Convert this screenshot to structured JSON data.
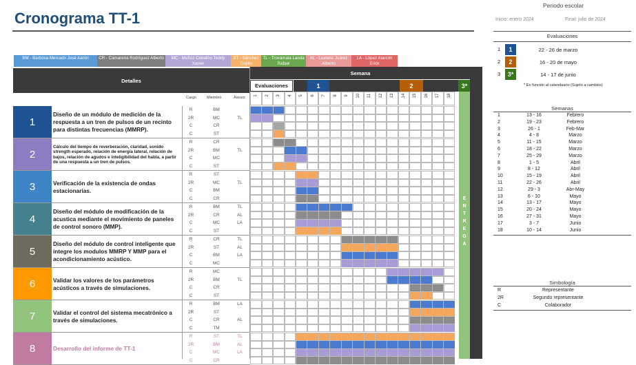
{
  "title": "Cronograma TT-1",
  "periodo": {
    "label": "Periodo escolar",
    "inicio": "Inicio:  enero 2024",
    "final": "Final:  julio de 2024"
  },
  "members": [
    {
      "text": "BM - Barbosa Mercado José Aarón",
      "color": "#5b9bd5"
    },
    {
      "text": "CR - Camarena Rodríguez Alberto",
      "color": "#7f7f7f"
    },
    {
      "text": "MC - Muñoz Ceballos Teddy Xavier",
      "color": "#b4a7d6"
    },
    {
      "text": "ST - Sánchez Trujillo",
      "color": "#f6b26b"
    },
    {
      "text": "TL - Trovamala Landa Rafael",
      "color": "#6aa84f"
    },
    {
      "text": "AL - Luviano Juárez Alberto",
      "color": "#ea9999"
    },
    {
      "text": "LA - López Alarcón Erick",
      "color": "#e06666"
    }
  ],
  "table": {
    "detalles": "Detalles",
    "cargo": "Cargo",
    "miembro": "Miembro",
    "asesor": "Asesor",
    "semana": "Semana",
    "evaluaciones": "Evaluaciones",
    "eval_marks": [
      "1",
      "2",
      "3*"
    ],
    "weeks": [
      "1",
      "2",
      "3",
      "4",
      "5",
      "6",
      "7",
      "8",
      "9",
      "10",
      "11",
      "12",
      "13",
      "14",
      "15",
      "16",
      "17",
      "18"
    ],
    "entrega": "ENTREGA"
  },
  "tasks": [
    {
      "num": "1",
      "color": "#1f5394",
      "desc": "Diseño de un módulo de medición de la respuesta a un tren de pulsos de un recinto para distintas frecuencias (MMRP).",
      "small": false,
      "cargos": [
        "R",
        "2R",
        "C",
        "C"
      ],
      "miembros": [
        "BM",
        "MC",
        "CR",
        "ST"
      ],
      "asesores": [
        "",
        "TL",
        "",
        ""
      ],
      "bars": [
        [
          1,
          3,
          "#4a7bd0"
        ],
        [
          1,
          2,
          "#a99bd6"
        ],
        [
          3,
          3,
          "#a5a5a5"
        ],
        [
          3,
          3,
          "#f6a75e"
        ]
      ]
    },
    {
      "num": "2",
      "color": "#8e7cc3",
      "desc": "Cálculo del tiempo de reverberación, claridad, sonido strength esperado, relación de energía lateral, relación de bajos, relación de agudos e inteligibilidad del habla, a partir de una respuesta a un tren de pulsos.",
      "small": true,
      "cargos": [
        "R",
        "2R",
        "C",
        "C"
      ],
      "miembros": [
        "CR",
        "BM",
        "MC",
        "ST"
      ],
      "asesores": [
        "",
        "TL",
        "",
        ""
      ],
      "bars": [
        [
          3,
          4,
          "#8c8c8c"
        ],
        [
          4,
          5,
          "#4a7bd0"
        ],
        [
          4,
          5,
          "#a99bd6"
        ],
        [
          3,
          4,
          "#f6a75e"
        ]
      ]
    },
    {
      "num": "3",
      "color": "#3d85c6",
      "desc": "Verificación de la existencia de ondas estacionarias.",
      "small": false,
      "cargos": [
        "R",
        "2R",
        "C",
        "C"
      ],
      "miembros": [
        "ST",
        "MC",
        "BM",
        "CR"
      ],
      "asesores": [
        "",
        "TL",
        "",
        ""
      ],
      "bars": [
        [
          5,
          6,
          "#f6a75e"
        ],
        [
          5,
          6,
          "#a99bd6"
        ],
        [
          5,
          6,
          "#4a7bd0"
        ],
        [
          5,
          6,
          "#8c8c8c"
        ]
      ]
    },
    {
      "num": "4",
      "color": "#45818e",
      "desc": "Diseño del módulo de modificación de la acustica mediante el movimiento de paneles de control sonoro (MMP).",
      "small": false,
      "cargos": [
        "R",
        "2R",
        "C",
        "C"
      ],
      "miembros": [
        "BM",
        "CR",
        "MC",
        "ST"
      ],
      "asesores": [
        "TL",
        "AL",
        "LA",
        ""
      ],
      "bars": [
        [
          5,
          9,
          "#4a7bd0"
        ],
        [
          5,
          8,
          "#8c8c8c"
        ],
        [
          5,
          8,
          "#a99bd6"
        ],
        [
          5,
          8,
          "#f6a75e"
        ]
      ]
    },
    {
      "num": "5",
      "color": "#6d6a5e",
      "desc": "Diseño del módulo de control inteligente que integre los modulos MMRP Y MMP para el acondicionamiento acústico.",
      "small": false,
      "cargos": [
        "R",
        "2R",
        "C",
        "C"
      ],
      "miembros": [
        "CR",
        "ST",
        "BM",
        "MC"
      ],
      "asesores": [
        "TL",
        "AL",
        "LA",
        ""
      ],
      "bars": [
        [
          9,
          13,
          "#8c8c8c"
        ],
        [
          9,
          13,
          "#f6a75e"
        ],
        [
          9,
          13,
          "#4a7bd0"
        ],
        [
          9,
          13,
          "#a99bd6"
        ]
      ]
    },
    {
      "num": "6",
      "color": "#ff9900",
      "desc": "Validar los valores de los parámetros acústicos a través de simulaciones.",
      "small": false,
      "cargos": [
        "R",
        "2R",
        "C",
        "C"
      ],
      "miembros": [
        "MC",
        "BM",
        "CR",
        "ST"
      ],
      "asesores": [
        "",
        "TL",
        "",
        ""
      ],
      "bars": [
        [
          13,
          17,
          "#a99bd6"
        ],
        [
          13,
          16,
          "#4a7bd0"
        ],
        [
          15,
          17,
          "#8c8c8c"
        ],
        [
          15,
          16,
          "#f6a75e"
        ]
      ]
    },
    {
      "num": "7",
      "color": "#93c47d",
      "desc": "Validar el control del sistema mecatrónico a través de simulaciones.",
      "small": false,
      "cargos": [
        "R",
        "2R",
        "C",
        "C"
      ],
      "miembros": [
        "BM",
        "ST",
        "CR",
        "TM"
      ],
      "asesores": [
        "LA",
        "",
        "AL",
        ""
      ],
      "bars": [
        [
          15,
          18,
          "#4a7bd0"
        ],
        [
          15,
          18,
          "#f6a75e"
        ],
        [
          15,
          18,
          "#8c8c8c"
        ],
        [
          15,
          18,
          "#a99bd6"
        ]
      ]
    },
    {
      "num": "8",
      "color": "#c27ba0",
      "desc": "Desarrollo del informe de TT-1",
      "small": false,
      "pink": true,
      "cargos": [
        "R",
        "2R",
        "C",
        "C"
      ],
      "miembros": [
        "ST",
        "BM",
        "MC",
        "CR"
      ],
      "asesores": [
        "TL",
        "AL",
        "LA",
        ""
      ],
      "bars": [
        [
          5,
          18,
          "#f6a75e"
        ],
        [
          5,
          18,
          "#4a7bd0"
        ],
        [
          5,
          18,
          "#a99bd6"
        ],
        [
          5,
          18,
          "#8c8c8c"
        ]
      ]
    }
  ],
  "evaluaciones": {
    "title": "Evaluaciones",
    "items": [
      {
        "n": "1",
        "mark": "1",
        "color": "#1f5394",
        "range": "22 - 26 de marzo"
      },
      {
        "n": "2",
        "mark": "2",
        "color": "#b45f06",
        "range": "16 - 20 de mayo"
      },
      {
        "n": "3",
        "mark": "3*",
        "color": "#38761d",
        "range": "14 - 17 de junio"
      }
    ],
    "note": "* En función al calendaario (Sujeto a cambios)"
  },
  "semanas": {
    "title": "Semanas",
    "rows": [
      [
        "1",
        "13 - 16",
        "Febrero"
      ],
      [
        "2",
        "19 - 23",
        "Febrero"
      ],
      [
        "3",
        "26 - 1",
        "Feb-Mar"
      ],
      [
        "4",
        "4 - 8",
        "Marzo"
      ],
      [
        "5",
        "11 - 15",
        "Marzo"
      ],
      [
        "6",
        "18 - 22",
        "Marzo"
      ],
      [
        "7",
        "25 - 29",
        "Marzo"
      ],
      [
        "8",
        "1 - 5",
        "Abril"
      ],
      [
        "9",
        "8 - 12",
        "Abril"
      ],
      [
        "10",
        "15 - 19",
        "Abril"
      ],
      [
        "11",
        "22 - 26",
        "Abril"
      ],
      [
        "12",
        "29 - 3",
        "Abr-May"
      ],
      [
        "13",
        "6 - 10",
        "Mayo"
      ],
      [
        "14",
        "13 - 17",
        "Mayo"
      ],
      [
        "15",
        "20 - 24",
        "Mayo"
      ],
      [
        "16",
        "27 - 31",
        "Mayo"
      ],
      [
        "17",
        "3 - 7",
        "Junio"
      ],
      [
        "18",
        "10 - 14",
        "Junio"
      ]
    ]
  },
  "simbologia": {
    "title": "Simbología",
    "rows": [
      [
        "R",
        "Representante"
      ],
      [
        "2R",
        "Segundo representante"
      ],
      [
        "C",
        "Colaborador"
      ]
    ]
  }
}
